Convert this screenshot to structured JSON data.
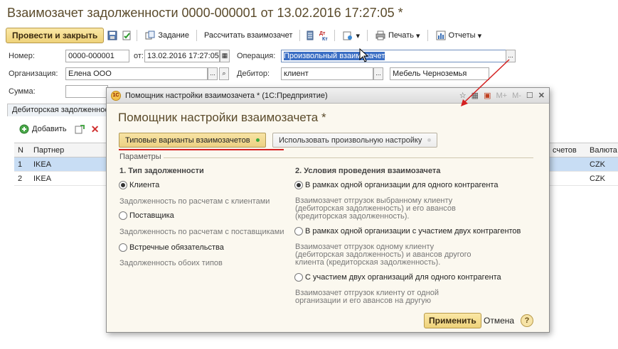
{
  "main": {
    "title": "Взаимозачет задолженности 0000-000001 от 13.02.2016 17:27:05 *",
    "toolbar": {
      "post_close": "Провести и закрыть",
      "task": "Задание",
      "calculate": "Рассчитать взаимозачет",
      "dt_kt": "Дт Кт",
      "print": "Печать",
      "reports": "Отчеты"
    },
    "fields": {
      "number_label": "Номер:",
      "number_value": "0000-000001",
      "from_label": "от:",
      "date_value": "13.02.2016 17:27:05",
      "operation_label": "Операция:",
      "operation_value": "Произвольный взаимозачет",
      "org_label": "Организация:",
      "org_value": "Елена ООО",
      "debtor_label": "Дебитор:",
      "debtor_value": "клиент",
      "debtor_company": "Мебель Черноземья",
      "sum_label": "Сумма:"
    },
    "tab": "Дебиторская задолженность",
    "list_toolbar": {
      "add": "Добавить"
    },
    "table": {
      "headers": {
        "n": "N",
        "partner": "Партнер",
        "settlements": "счетов",
        "currency": "Валюта"
      },
      "rows": [
        {
          "n": "1",
          "partner": "IKEA",
          "currency": "CZK"
        },
        {
          "n": "2",
          "partner": "IKEA",
          "currency": "CZK"
        }
      ]
    }
  },
  "dialog": {
    "window_title": "Помощник настройки взаимозачета * (1С:Предприятие)",
    "heading": "Помощник настройки взаимозачета *",
    "logo_text": "1С",
    "controls": {
      "m_plus": "M+",
      "m_minus": "M-"
    },
    "tabs": {
      "typical": "Типовые варианты взаимозачетов",
      "custom": "Использовать произвольную настройку"
    },
    "params_group": "Параметры",
    "section1": {
      "title": "1. Тип задолженности",
      "options": [
        {
          "label": "Клиента",
          "hint": "Задолженность по расчетам с клиентами",
          "checked": true
        },
        {
          "label": "Поставщика",
          "hint": "Задолженность по расчетам с поставщиками",
          "checked": false
        },
        {
          "label": "Встречные обязательства",
          "hint": "Задолженность обоих типов",
          "checked": false
        }
      ]
    },
    "section2": {
      "title": "2. Условия проведения взаимозачета",
      "options": [
        {
          "label": "В рамках одной организации для одного контрагента",
          "checked": true,
          "hint": [
            "Взаимозачет отгрузок выбранному клиенту",
            "(дебиторская задолженность) и его авансов",
            "(кредиторская задолженность)."
          ]
        },
        {
          "label": "В рамках одной организации с участием двух контрагентов",
          "checked": false,
          "hint": [
            "Взаимозачет отгрузок одному клиенту",
            "(дебиторская задолженность) и авансов другого",
            "клиента (кредиторская задолженность)."
          ]
        },
        {
          "label": "С участием двух организаций для одного контрагента",
          "checked": false,
          "hint": [
            "Взаимозачет отгрузок клиенту от одной",
            "организации и его авансов на другую"
          ]
        }
      ]
    },
    "buttons": {
      "apply": "Применить",
      "cancel": "Отмена",
      "help": "?"
    }
  },
  "colors": {
    "accent": "#eed27a",
    "annotation": "#d42020",
    "selection": "#c8ddf4"
  }
}
